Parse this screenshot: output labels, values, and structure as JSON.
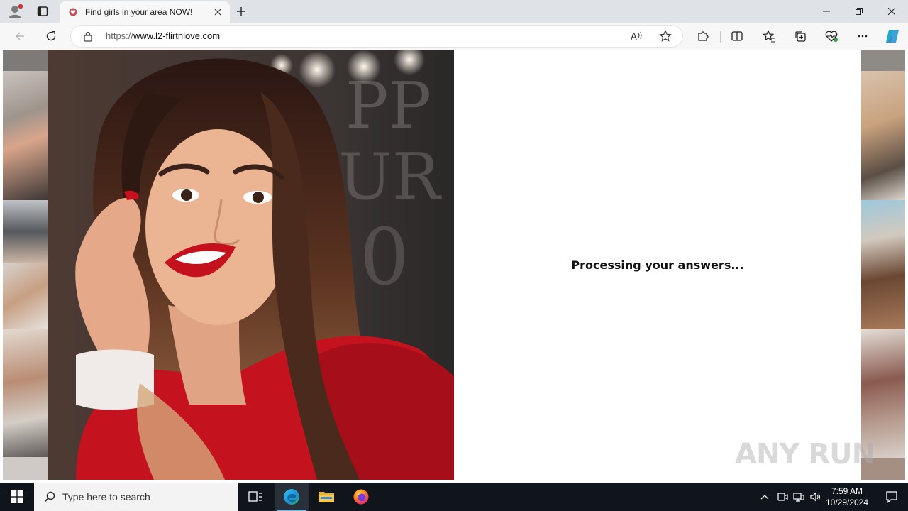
{
  "browser": {
    "tab": {
      "title": "Find girls in your area NOW!",
      "favicon": "heart-favicon-icon"
    },
    "address": {
      "scheme": "https://",
      "host": "www.l2-flirtnlove.com"
    },
    "icons": {
      "profile": "profile-icon",
      "tab_actions": "tab-actions-icon",
      "new_tab": "plus-icon",
      "back": "back-arrow-icon",
      "reload": "reload-icon",
      "lock": "lock-icon",
      "read_aloud": "read-aloud-icon",
      "favorite": "star-icon",
      "extensions": "puzzle-icon",
      "split_screen": "split-screen-icon",
      "favorites": "favorites-icon",
      "collections": "collections-icon",
      "browser_essentials": "heart-pulse-icon",
      "more": "more-icon",
      "copilot": "copilot-icon"
    },
    "colors": {
      "accent": "#0078d4"
    }
  },
  "page": {
    "status_text": "Processing your answers...",
    "watermark": "ANY RUN"
  },
  "taskbar": {
    "search_placeholder": "Type here to search",
    "time": "7:59 AM",
    "date": "10/29/2024",
    "apps": [
      "Task View",
      "Microsoft Edge",
      "File Explorer",
      "Firefox"
    ]
  }
}
